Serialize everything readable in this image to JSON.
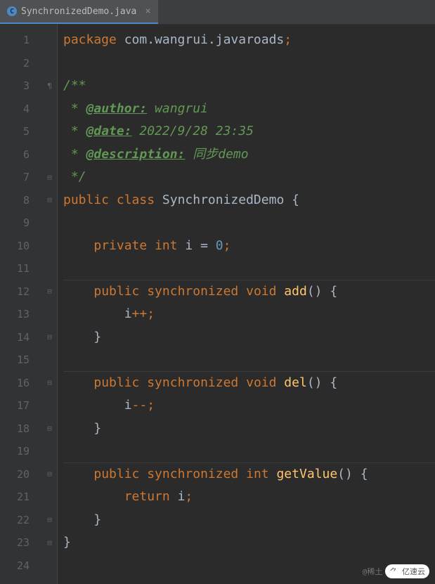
{
  "tab": {
    "icon_letter": "C",
    "filename": "SynchronizedDemo.java",
    "close": "×"
  },
  "lines": {
    "l1_kw": "package",
    "l1_pkg": " com.wangrui.javaroads",
    "l1_semi": ";",
    "l3": "/**",
    "l4_pre": " * ",
    "l4_tag": "@author:",
    "l4_val": " wangrui",
    "l5_pre": " * ",
    "l5_tag": "@date:",
    "l5_val": " 2022/9/28 23:35",
    "l6_pre": " * ",
    "l6_tag": "@description:",
    "l6_val": " 同步demo",
    "l7": " */",
    "l8_pub": "public ",
    "l8_cls": "class ",
    "l8_name": "SynchronizedDemo ",
    "l8_brace": "{",
    "l10_ind": "    ",
    "l10_priv": "private ",
    "l10_int": "int ",
    "l10_i": "i ",
    "l10_eq": "= ",
    "l10_zero": "0",
    "l10_semi": ";",
    "l12_ind": "    ",
    "l12_pub": "public ",
    "l12_sync": "synchronized ",
    "l12_void": "void ",
    "l12_name": "add",
    "l12_paren": "()",
    "l12_brace": " {",
    "l13_ind": "        ",
    "l13_i": "i",
    "l13_op": "++;",
    "l14_ind": "    ",
    "l14_brace": "}",
    "l16_ind": "    ",
    "l16_pub": "public ",
    "l16_sync": "synchronized ",
    "l16_void": "void ",
    "l16_name": "del",
    "l16_paren": "()",
    "l16_brace": " {",
    "l17_ind": "        ",
    "l17_i": "i",
    "l17_op": "--;",
    "l18_ind": "    ",
    "l18_brace": "}",
    "l20_ind": "    ",
    "l20_pub": "public ",
    "l20_sync": "synchronized ",
    "l20_int": "int ",
    "l20_name": "getValue",
    "l20_paren": "()",
    "l20_brace": " {",
    "l21_ind": "        ",
    "l21_ret": "return ",
    "l21_i": "i",
    "l21_semi": ";",
    "l22_ind": "    ",
    "l22_brace": "}",
    "l23_brace": "}"
  },
  "line_numbers": [
    "1",
    "2",
    "3",
    "4",
    "5",
    "6",
    "7",
    "8",
    "9",
    "10",
    "11",
    "12",
    "13",
    "14",
    "15",
    "16",
    "17",
    "18",
    "19",
    "20",
    "21",
    "22",
    "23",
    "24"
  ],
  "watermark": {
    "text1": "@稀土",
    "logo": "⺈ 亿速云"
  }
}
